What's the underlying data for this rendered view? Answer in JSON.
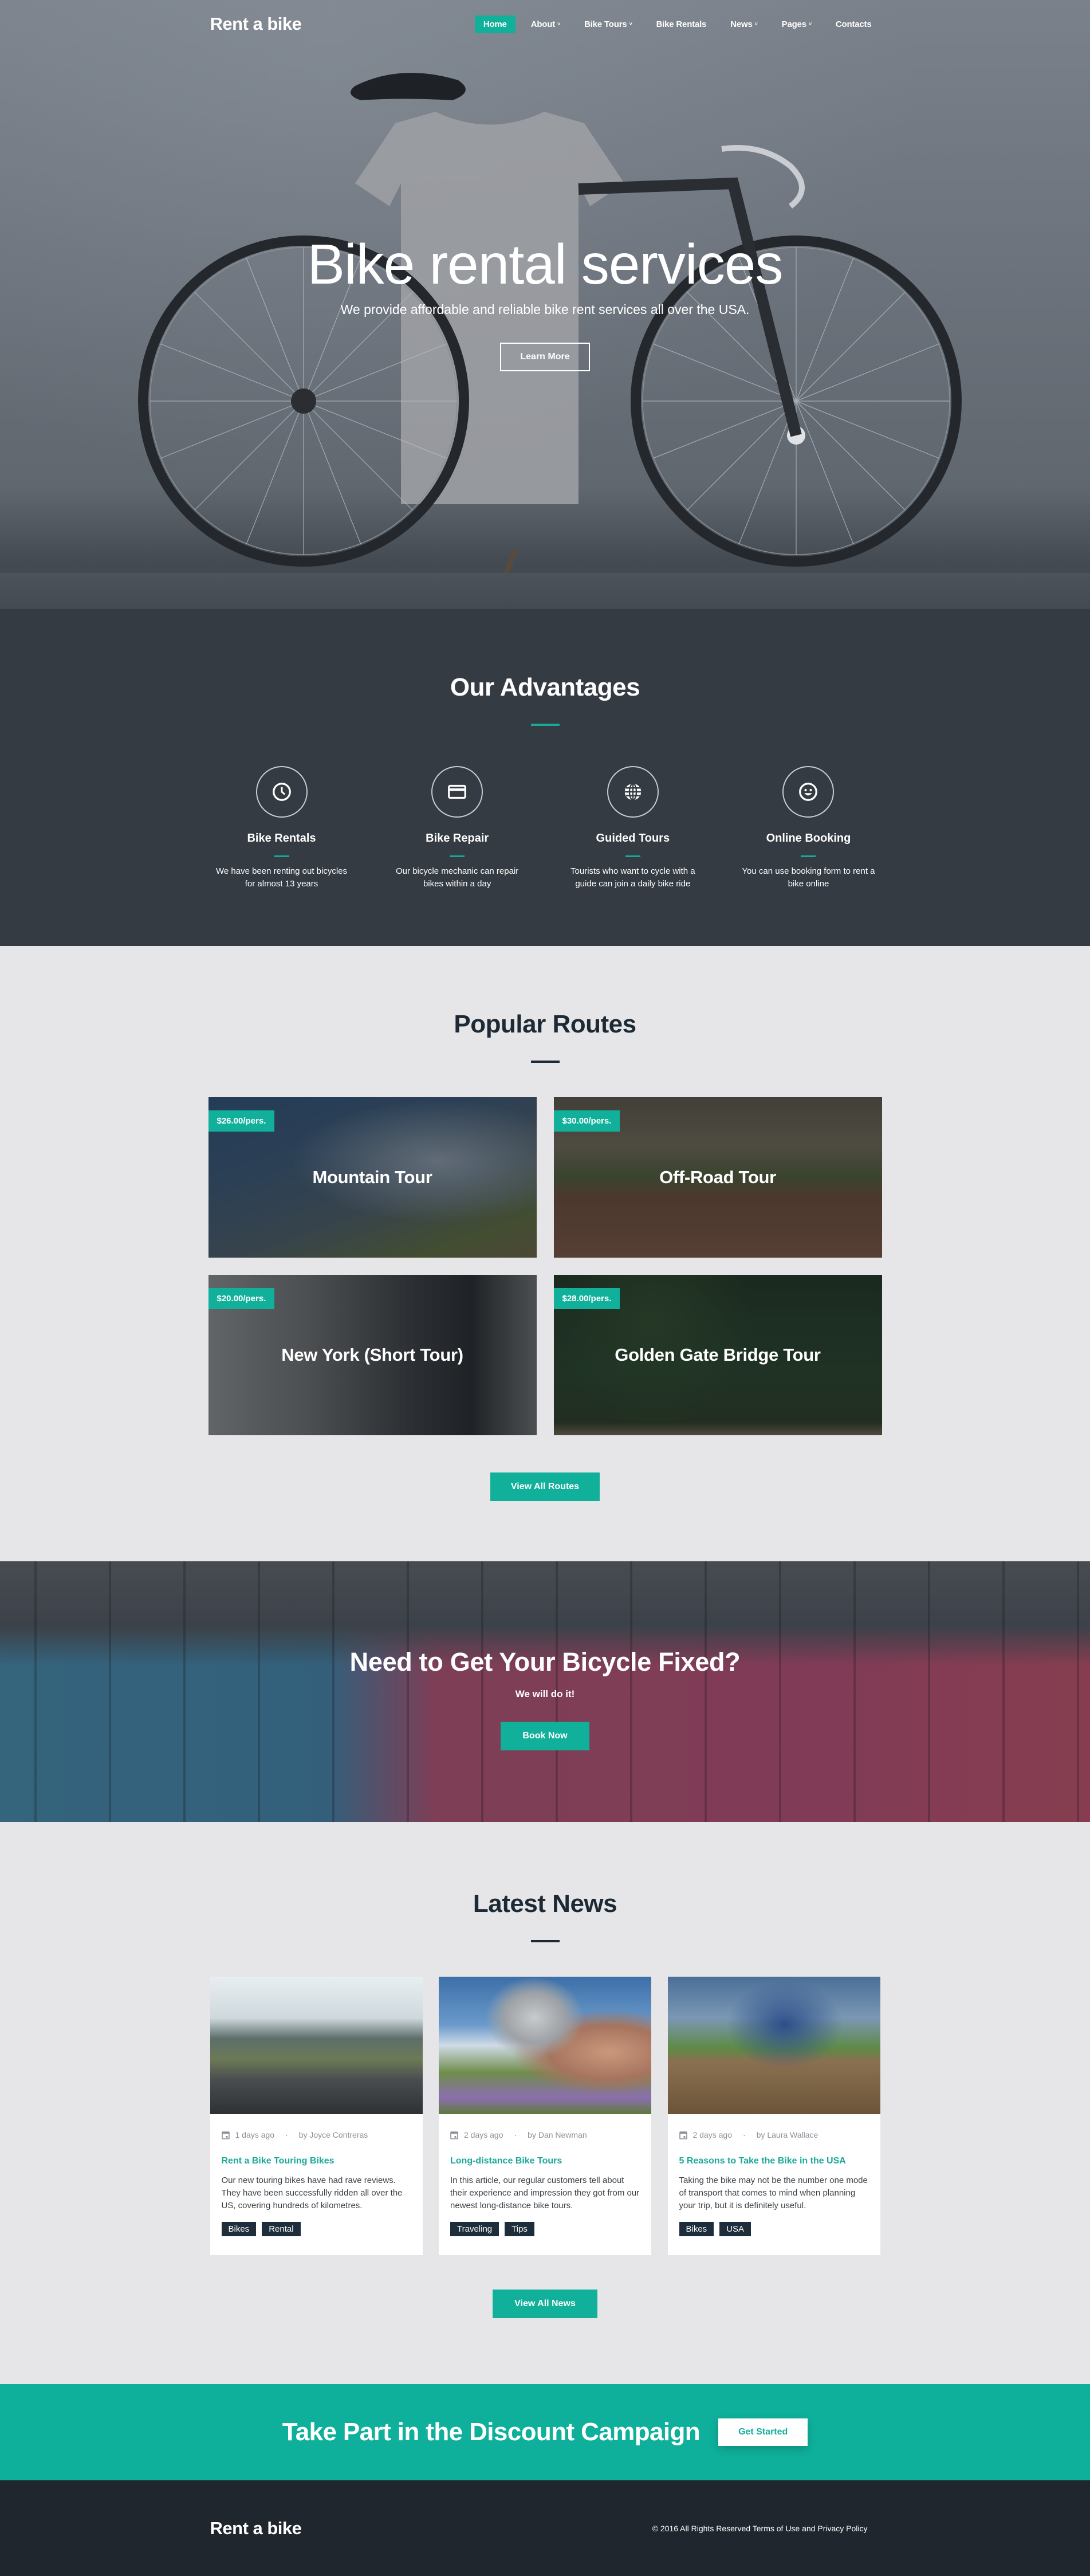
{
  "brand": {
    "name": "Rent a bike",
    "accent_color": "#11b09b",
    "dark_color": "#1d2a35"
  },
  "nav": {
    "items": [
      {
        "label": "Home",
        "active": true,
        "has_dropdown": false
      },
      {
        "label": "About",
        "active": false,
        "has_dropdown": true
      },
      {
        "label": "Bike Tours",
        "active": false,
        "has_dropdown": true
      },
      {
        "label": "Bike Rentals",
        "active": false,
        "has_dropdown": false
      },
      {
        "label": "News",
        "active": false,
        "has_dropdown": true
      },
      {
        "label": "Pages",
        "active": false,
        "has_dropdown": true
      },
      {
        "label": "Contacts",
        "active": false,
        "has_dropdown": false
      }
    ],
    "caret": "˅"
  },
  "hero": {
    "title": "Bike rental services",
    "subtitle": "We provide affordable and reliable bike rent services all over the USA.",
    "button_label": "Learn More"
  },
  "advantages": {
    "title": "Our Advantages",
    "items": [
      {
        "icon": "clock-icon",
        "name": "Bike Rentals",
        "description": "We have been renting out bicycles for almost 13 years"
      },
      {
        "icon": "credit-card-icon",
        "name": "Bike Repair",
        "description": "Our bicycle mechanic can repair bikes within a day"
      },
      {
        "icon": "globe-icon",
        "name": "Guided Tours",
        "description": "Tourists who want to cycle with a guide can join a daily bike ride"
      },
      {
        "icon": "smiley-icon",
        "name": "Online Booking",
        "description": "You can use booking form to rent a bike online"
      }
    ]
  },
  "routes": {
    "title": "Popular Routes",
    "items": [
      {
        "price": "$26.00/pers.",
        "name": "Mountain Tour"
      },
      {
        "price": "$30.00/pers.",
        "name": "Off-Road Tour"
      },
      {
        "price": "$20.00/pers.",
        "name": "New York (Short Tour)"
      },
      {
        "price": "$28.00/pers.",
        "name": "Golden Gate Bridge Tour"
      }
    ],
    "button_label": "View All Routes"
  },
  "repair": {
    "title": "Need to Get Your Bicycle Fixed?",
    "subtitle": "We will do it!",
    "button_label": "Book Now"
  },
  "news": {
    "title": "Latest News",
    "items": [
      {
        "date": "1 days ago",
        "author": "by Joyce Contreras",
        "title": "Rent a Bike Touring Bikes",
        "text": "Our new touring bikes have had rave reviews. They have been successfully ridden all over the US, covering hundreds of kilometres.",
        "tags": [
          "Bikes",
          "Rental"
        ]
      },
      {
        "date": "2 days ago",
        "author": "by Dan Newman",
        "title": "Long-distance Bike Tours",
        "text": "In this article, our regular customers tell about their experience and impression they got from our newest long-distance bike tours.",
        "tags": [
          "Traveling",
          "Tips"
        ]
      },
      {
        "date": "2 days ago",
        "author": "by Laura Wallace",
        "title": "5 Reasons to Take the Bike in the USA",
        "text": "Taking the bike may not be the number one mode of transport that comes to mind when planning your trip, but it is definitely useful.",
        "tags": [
          "Bikes",
          "USA"
        ]
      }
    ],
    "separator": "·",
    "button_label": "View All News"
  },
  "cta": {
    "title": "Take Part in the Discount Campaign",
    "button_label": "Get Started"
  },
  "footer": {
    "logo": "Rent a bike",
    "copyright": "© 2016 All Rights Reserved Terms of Use and Privacy Policy"
  }
}
